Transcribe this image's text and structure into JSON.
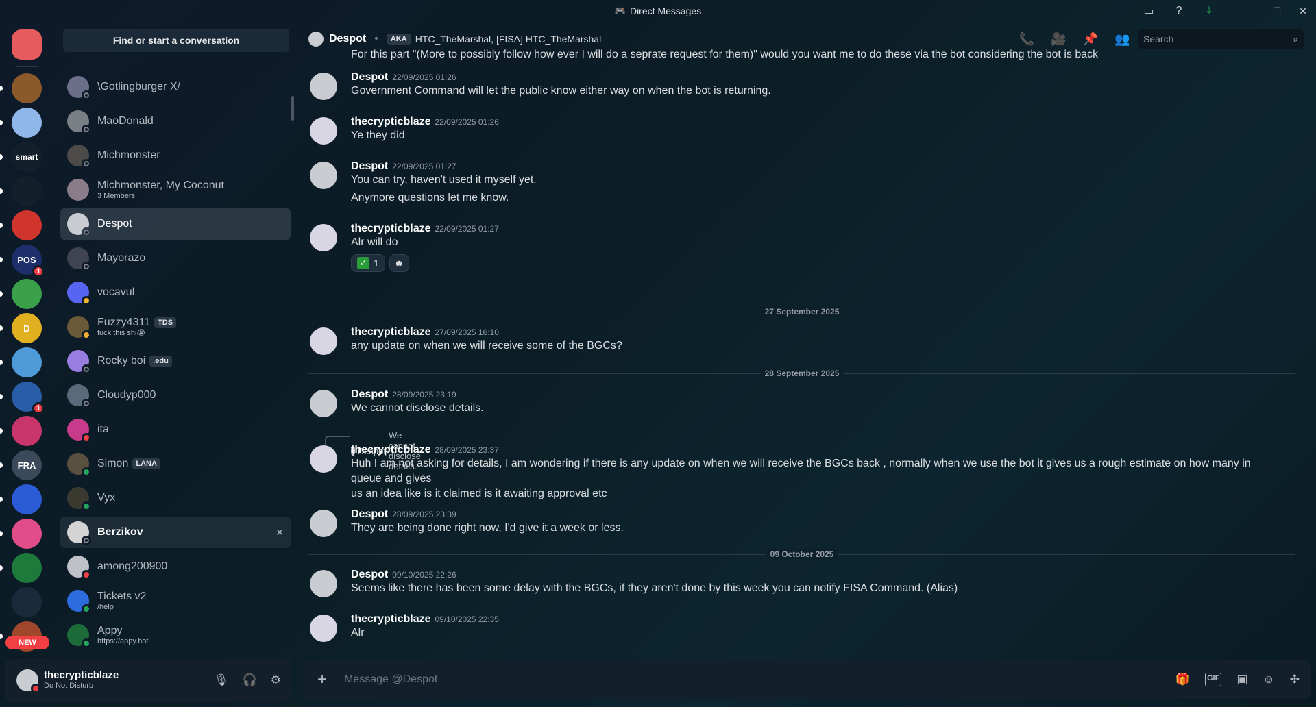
{
  "window": {
    "title": "Direct Messages"
  },
  "rail": {
    "servers": [
      {
        "name": "discord-home",
        "label": "",
        "color": "#e65b5b",
        "pill": true
      },
      {
        "name": "server-1",
        "label": "",
        "color": "#8a5a2a"
      },
      {
        "name": "server-2",
        "label": "",
        "color": "#8fb7e8"
      },
      {
        "name": "server-smart",
        "label": "smart",
        "color": "#13202c"
      },
      {
        "name": "server-4",
        "label": "",
        "color": "#13202c"
      },
      {
        "name": "server-5",
        "label": "",
        "color": "#d0352d"
      },
      {
        "name": "server-easy-pos",
        "label": "POS",
        "color": "#1d2f6b",
        "badge": "1"
      },
      {
        "name": "server-7",
        "label": "",
        "color": "#3aa04a"
      },
      {
        "name": "server-8",
        "label": "D",
        "color": "#e0b020"
      },
      {
        "name": "server-9",
        "label": "",
        "color": "#4f9ad8"
      },
      {
        "name": "server-10",
        "label": "",
        "color": "#2a5da8",
        "badge": "1"
      },
      {
        "name": "server-11",
        "label": "",
        "color": "#c8356a"
      },
      {
        "name": "server-12",
        "label": "FRA",
        "color": "#3b4a5a"
      },
      {
        "name": "server-13",
        "label": "",
        "color": "#2c5bd8"
      },
      {
        "name": "server-14",
        "label": "",
        "color": "#e04d88"
      },
      {
        "name": "server-15",
        "label": "",
        "color": "#1e7a3b"
      },
      {
        "name": "folder",
        "label": "",
        "color": "#1b2a3a"
      },
      {
        "name": "server-17",
        "label": "",
        "color": "#a0462a"
      }
    ],
    "new_label": "NEW"
  },
  "sidebar": {
    "find_label": "Find or start a conversation",
    "dms": [
      {
        "id": "gotlingburger",
        "name": "\\Gotlingburger X/",
        "status": "offline",
        "color": "#6b6f8a"
      },
      {
        "id": "maodonald",
        "name": "MaoDonald",
        "status": "offline",
        "color": "#7a7f86"
      },
      {
        "id": "michmonster",
        "name": "Michmonster",
        "status": "offline",
        "color": "#4d4a4a"
      },
      {
        "id": "michmonster-coconut",
        "name": "Michmonster, My Coconut",
        "sub": "3 Members",
        "status": "",
        "color": "#8a7c88"
      },
      {
        "id": "despot",
        "name": "Despot",
        "status": "offline",
        "color": "#c9ccd1",
        "active": true
      },
      {
        "id": "mayorazo",
        "name": "Mayorazo",
        "status": "offline",
        "color": "#3f4450"
      },
      {
        "id": "vocavul",
        "name": "vocavul",
        "status": "idle",
        "color": "#5865f2"
      },
      {
        "id": "fuzzy4311",
        "name": "Fuzzy4311",
        "tag": "TDS",
        "sub": "fuck this shi😭",
        "status": "idle",
        "color": "#6a5a3a"
      },
      {
        "id": "rocky-boi",
        "name": "Rocky boi",
        "tag": ".edu",
        "status": "offline",
        "color": "#9a7de0"
      },
      {
        "id": "cloudyp000",
        "name": "Cloudyp000",
        "status": "offline",
        "color": "#5a6a7a"
      },
      {
        "id": "ita",
        "name": "ita",
        "status": "dnd",
        "color": "#c83a8a"
      },
      {
        "id": "simon",
        "name": "Simon",
        "tag": "LANA",
        "status": "online",
        "color": "#5a5040"
      },
      {
        "id": "vyx",
        "name": "Vyx",
        "status": "online",
        "color": "#3a3a30"
      },
      {
        "id": "berzikov",
        "name": "Berzikov",
        "status": "offline",
        "color": "#d4d4d4",
        "hover": true
      },
      {
        "id": "among200900",
        "name": "among200900",
        "status": "dnd",
        "color": "#c0c0c8"
      },
      {
        "id": "tickets-v2",
        "name": "Tickets v2",
        "sub": "/help",
        "status": "online",
        "color": "#2d6cdf"
      },
      {
        "id": "appy",
        "name": "Appy",
        "sub": "https://appy.bot",
        "status": "online",
        "color": "#1e6b3a"
      }
    ],
    "close_glyph": "✕"
  },
  "user": {
    "name": "thecrypticblaze",
    "status": "Do Not Disturb"
  },
  "header": {
    "name": "Despot",
    "aka_label": "AKA",
    "aka_names": "HTC_TheMarshal, [FISA] HTC_TheMarshal",
    "search_placeholder": "Search"
  },
  "messages": {
    "top_line": "For this part \"(More to possibly follow how ever I will do a seprate request for them)\" would you want me to do these via the bot considering the bot is back",
    "m1": {
      "author": "Despot",
      "ts": "22/09/2025 01:26",
      "lines": [
        "Government Command will let the public know either way on when the bot is returning."
      ]
    },
    "m2": {
      "author": "thecrypticblaze",
      "ts": "22/09/2025 01:26",
      "lines": [
        "Ye they did"
      ]
    },
    "m3": {
      "author": "Despot",
      "ts": "22/09/2025 01:27",
      "lines": [
        "You can try, haven't used it myself yet.",
        "Anymore questions let me know."
      ]
    },
    "m4": {
      "author": "thecrypticblaze",
      "ts": "22/09/2025 01:27",
      "lines": [
        "Alr will do"
      ],
      "reaction_count": "1"
    },
    "d1": "27 September 2025",
    "m5": {
      "author": "thecrypticblaze",
      "ts": "27/09/2025 16:10",
      "lines": [
        "any update on when we will receive some of the BGCs?"
      ]
    },
    "d2": "28 September 2025",
    "m6": {
      "author": "Despot",
      "ts": "28/09/2025 23:19",
      "lines": [
        "We cannot disclose details."
      ]
    },
    "reply": {
      "author": "Despot",
      "text": "We cannot disclose details."
    },
    "m7": {
      "author": "thecrypticblaze",
      "ts": "28/09/2025 23:37",
      "lines": [
        "Huh I am not asking for details, I am wondering if there is any update on when we will receive the BGCs back , normally when we use the bot it gives us a rough estimate on how many in queue and gives",
        "us an idea like is it claimed is it awaiting approval etc"
      ]
    },
    "m8": {
      "author": "Despot",
      "ts": "28/09/2025 23:39",
      "lines": [
        "They are being done right now, I'd give it a week or less."
      ]
    },
    "d3": "09 October 2025",
    "m9": {
      "author": "Despot",
      "ts": "09/10/2025 22:26",
      "lines": [
        "Seems like there has been some delay with the BGCs, if they aren't done by this week you can notify FISA Command. (Alias)"
      ]
    },
    "m10": {
      "author": "thecrypticblaze",
      "ts": "09/10/2025 22:35",
      "lines": [
        "Alr"
      ]
    }
  },
  "composer": {
    "placeholder": "Message @Despot"
  }
}
